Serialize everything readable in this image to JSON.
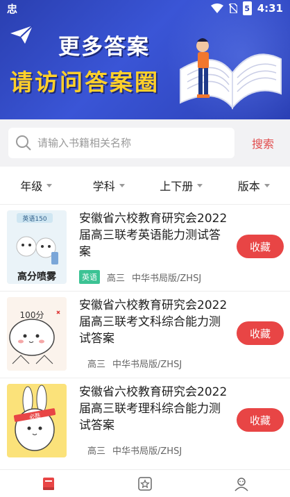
{
  "status_bar": {
    "left_glyph": "忠",
    "battery": "5",
    "time": "4:31"
  },
  "banner": {
    "line1": "更多答案",
    "line2": "请访问答案圈"
  },
  "search": {
    "placeholder": "请输入书籍相关名称",
    "value": "",
    "button_label": "搜索"
  },
  "filters": [
    {
      "label": "年级"
    },
    {
      "label": "学科"
    },
    {
      "label": "上下册"
    },
    {
      "label": "版本"
    }
  ],
  "books": [
    {
      "title": "安徽省六校教育研究会2022届高三联考英语能力测试答案",
      "subject_tag": "英语",
      "grade": "高三",
      "publisher": "中华书局版/ZHSJ",
      "fav_label": "收藏",
      "cover_text_top": "英语150",
      "cover_text_bottom": "高分喷雾"
    },
    {
      "title": "安徽省六校教育研究会2022届高三联考文科综合能力测试答案",
      "subject_tag": "",
      "grade": "高三",
      "publisher": "中华书局版/ZHSJ",
      "fav_label": "收藏",
      "cover_text_top": "100分"
    },
    {
      "title": "安徽省六校教育研究会2022届高三联考理科综合能力测试答案",
      "subject_tag": "",
      "grade": "高三",
      "publisher": "中华书局版/ZHSJ",
      "fav_label": "收藏",
      "cover_text_top": "必胜"
    }
  ],
  "bottom_nav": [
    {
      "icon": "book-icon",
      "active": true
    },
    {
      "icon": "star-icon",
      "active": false
    },
    {
      "icon": "user-icon",
      "active": false
    }
  ],
  "colors": {
    "accent": "#e84545",
    "banner": "#3a55d6",
    "banner_text_yellow": "#ffd02a",
    "tag_green": "#3cc394"
  }
}
